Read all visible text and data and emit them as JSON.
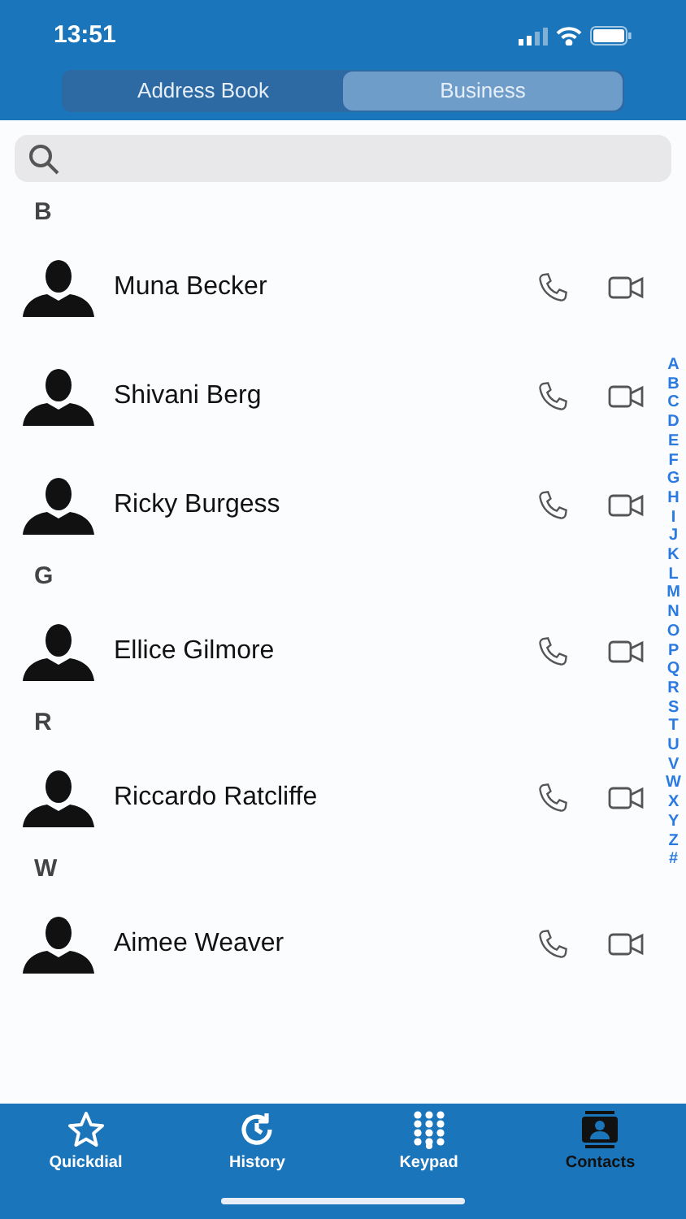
{
  "status_bar": {
    "time": "13:51"
  },
  "segments": [
    {
      "label": "Address Book",
      "selected": false
    },
    {
      "label": "Business",
      "selected": true
    }
  ],
  "sections": [
    {
      "letter": "B",
      "contacts": [
        {
          "name": "Muna Becker"
        },
        {
          "name": "Shivani Berg"
        },
        {
          "name": "Ricky Burgess"
        }
      ]
    },
    {
      "letter": "G",
      "contacts": [
        {
          "name": "Ellice Gilmore"
        }
      ]
    },
    {
      "letter": "R",
      "contacts": [
        {
          "name": "Riccardo Ratcliffe"
        }
      ]
    },
    {
      "letter": "W",
      "contacts": [
        {
          "name": "Aimee Weaver"
        }
      ]
    }
  ],
  "index": [
    "A",
    "B",
    "C",
    "D",
    "E",
    "F",
    "G",
    "H",
    "I",
    "J",
    "K",
    "L",
    "M",
    "N",
    "O",
    "P",
    "Q",
    "R",
    "S",
    "T",
    "U",
    "V",
    "W",
    "X",
    "Y",
    "Z",
    "#"
  ],
  "tabs": [
    {
      "label": "Quickdial",
      "kind": "star",
      "selected": false
    },
    {
      "label": "History",
      "kind": "history",
      "selected": false
    },
    {
      "label": "Keypad",
      "kind": "keypad",
      "selected": false
    },
    {
      "label": "Contacts",
      "kind": "contacts",
      "selected": true
    }
  ]
}
